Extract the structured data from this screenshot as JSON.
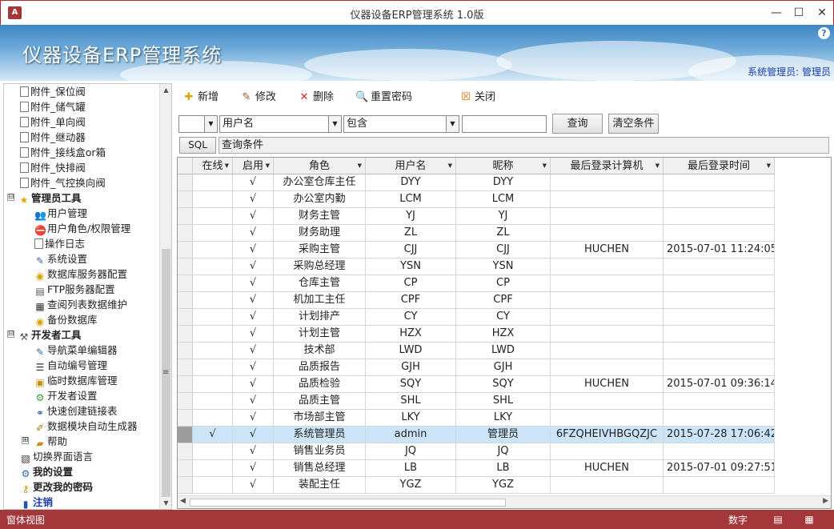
{
  "window": {
    "title": "仪器设备ERP管理系统 1.0版",
    "app_icon": "A",
    "controls": [
      "—",
      "☐",
      "✕"
    ]
  },
  "banner": {
    "title": "仪器设备ERP管理系统",
    "user_info": "系统管理员: 管理员",
    "help": "?"
  },
  "sidebar": {
    "items": [
      {
        "label": "附件_保位阀"
      },
      {
        "label": "附件_储气罐"
      },
      {
        "label": "附件_单向阀"
      },
      {
        "label": "附件_继动器"
      },
      {
        "label": "附件_接线盒or箱"
      },
      {
        "label": "附件_快排阀"
      },
      {
        "label": "附件_气控换向阀"
      },
      {
        "label": "管理员工具",
        "expander": "⊟"
      },
      {
        "label": "用户管理"
      },
      {
        "label": "用户角色/权限管理"
      },
      {
        "label": "操作日志"
      },
      {
        "label": "系统设置"
      },
      {
        "label": "数据库服务器配置"
      },
      {
        "label": "FTP服务器配置"
      },
      {
        "label": "查阅列表数据维护"
      },
      {
        "label": "备份数据库"
      },
      {
        "label": "开发者工具",
        "expander": "⊟"
      },
      {
        "label": "导航菜单编辑器"
      },
      {
        "label": "自动编号管理"
      },
      {
        "label": "临时数据库管理"
      },
      {
        "label": "开发者设置"
      },
      {
        "label": "快速创建链接表"
      },
      {
        "label": "数据模块自动生成器"
      },
      {
        "label": "帮助",
        "expander": "⊞"
      },
      {
        "label": "切换界面语言"
      },
      {
        "label": "我的设置"
      },
      {
        "label": "更改我的密码"
      },
      {
        "label": "注销"
      }
    ]
  },
  "toolbar": {
    "new_label": "新增",
    "edit_label": "修改",
    "delete_label": "删除",
    "reset_pwd_label": "重置密码",
    "close_label": "关闭"
  },
  "filter": {
    "field_combo_value": "",
    "column_combo_value": "用户名",
    "operator_combo_value": "包含",
    "value_input": "",
    "query_button": "查询",
    "clear_button": "清空条件",
    "sql_button": "SQL",
    "condition_text": "查询条件"
  },
  "grid": {
    "columns": [
      "在线",
      "启用",
      "角色",
      "用户名",
      "昵称",
      "最后登录计算机",
      "最后登录时间"
    ],
    "rows": [
      {
        "online": "",
        "enabled": "√",
        "role": "办公室仓库主任",
        "username": "DYY",
        "nickname": "DYY",
        "computer": "",
        "time": ""
      },
      {
        "online": "",
        "enabled": "√",
        "role": "办公室内勤",
        "username": "LCM",
        "nickname": "LCM",
        "computer": "",
        "time": ""
      },
      {
        "online": "",
        "enabled": "√",
        "role": "财务主管",
        "username": "YJ",
        "nickname": "YJ",
        "computer": "",
        "time": ""
      },
      {
        "online": "",
        "enabled": "√",
        "role": "财务助理",
        "username": "ZL",
        "nickname": "ZL",
        "computer": "",
        "time": ""
      },
      {
        "online": "",
        "enabled": "√",
        "role": "采购主管",
        "username": "CJJ",
        "nickname": "CJJ",
        "computer": "HUCHEN",
        "time": "2015-07-01 11:24:05"
      },
      {
        "online": "",
        "enabled": "√",
        "role": "采购总经理",
        "username": "YSN",
        "nickname": "YSN",
        "computer": "",
        "time": ""
      },
      {
        "online": "",
        "enabled": "√",
        "role": "仓库主管",
        "username": "CP",
        "nickname": "CP",
        "computer": "",
        "time": ""
      },
      {
        "online": "",
        "enabled": "√",
        "role": "机加工主任",
        "username": "CPF",
        "nickname": "CPF",
        "computer": "",
        "time": ""
      },
      {
        "online": "",
        "enabled": "√",
        "role": "计划排产",
        "username": "CY",
        "nickname": "CY",
        "computer": "",
        "time": ""
      },
      {
        "online": "",
        "enabled": "√",
        "role": "计划主管",
        "username": "HZX",
        "nickname": "HZX",
        "computer": "",
        "time": ""
      },
      {
        "online": "",
        "enabled": "√",
        "role": "技术部",
        "username": "LWD",
        "nickname": "LWD",
        "computer": "",
        "time": ""
      },
      {
        "online": "",
        "enabled": "√",
        "role": "品质报告",
        "username": "GJH",
        "nickname": "GJH",
        "computer": "",
        "time": ""
      },
      {
        "online": "",
        "enabled": "√",
        "role": "品质检验",
        "username": "SQY",
        "nickname": "SQY",
        "computer": "HUCHEN",
        "time": "2015-07-01 09:36:14"
      },
      {
        "online": "",
        "enabled": "√",
        "role": "品质主管",
        "username": "SHL",
        "nickname": "SHL",
        "computer": "",
        "time": ""
      },
      {
        "online": "",
        "enabled": "√",
        "role": "市场部主管",
        "username": "LKY",
        "nickname": "LKY",
        "computer": "",
        "time": ""
      },
      {
        "online": "√",
        "enabled": "√",
        "role": "系统管理员",
        "username": "admin",
        "nickname": "管理员",
        "computer": "6FZQHEIVHBGQZJC",
        "time": "2015-07-28 17:06:42"
      },
      {
        "online": "",
        "enabled": "√",
        "role": "销售业务员",
        "username": "JQ",
        "nickname": "JQ",
        "computer": "",
        "time": ""
      },
      {
        "online": "",
        "enabled": "√",
        "role": "销售总经理",
        "username": "LB",
        "nickname": "LB",
        "computer": "HUCHEN",
        "time": "2015-07-01 09:27:51"
      },
      {
        "online": "",
        "enabled": "√",
        "role": "装配主任",
        "username": "YGZ",
        "nickname": "YGZ",
        "computer": "",
        "time": ""
      }
    ]
  },
  "statusbar": {
    "left_text": "窗体视图",
    "num_text": "数字"
  },
  "colors": {
    "accent": "#a4373a",
    "selection": "#cce4f7",
    "link_blue": "#1a3fa8"
  }
}
